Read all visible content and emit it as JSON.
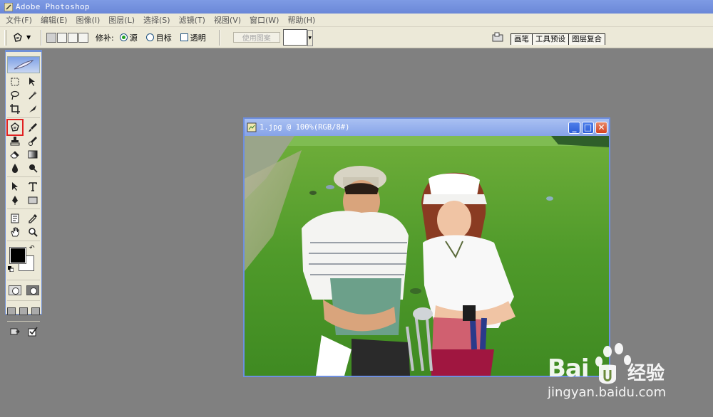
{
  "app": {
    "title": "Adobe Photoshop"
  },
  "menu": [
    "文件(F)",
    "编辑(E)",
    "图像(I)",
    "图层(L)",
    "选择(S)",
    "滤镜(T)",
    "视图(V)",
    "窗口(W)",
    "帮助(H)"
  ],
  "options": {
    "patch_label": "修补:",
    "source_label": "源",
    "destination_label": "目标",
    "transparent_label": "透明",
    "use_pattern_label": "使用图案",
    "source_checked": true,
    "destination_checked": false,
    "transparent_checked": false
  },
  "palette_tabs": [
    "画笔",
    "工具预设",
    "图层复合"
  ],
  "document": {
    "title": "1.jpg @ 100%(RGB/8#)",
    "minimize_label": "_",
    "maximize_label": "□",
    "close_label": "✕"
  },
  "colors": {
    "foreground": "#000000",
    "background": "#ffffff",
    "highlight": "#e02020"
  },
  "watermark": {
    "brand": "Bai",
    "product": "经验",
    "url": "jingyan.baidu.com"
  }
}
